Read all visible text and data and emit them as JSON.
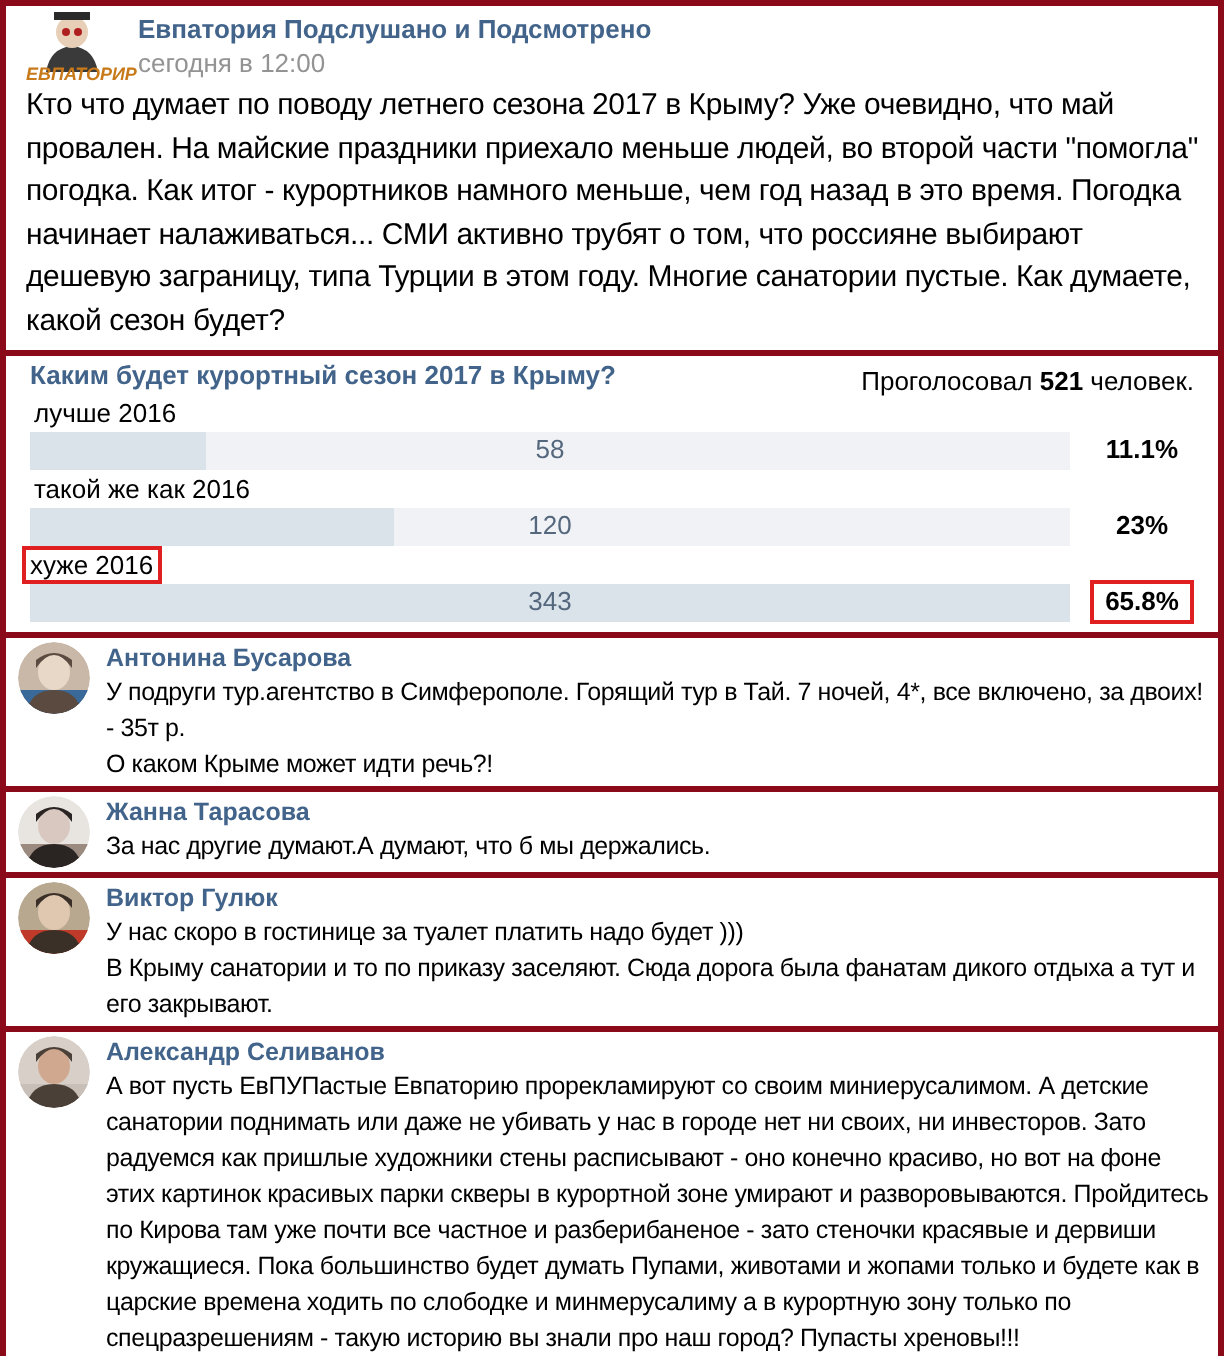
{
  "post": {
    "logo_text": "ЕВПАТОРИР",
    "author": "Евпатория Подслушано и Подсмотрено",
    "time": "сегодня в 12:00",
    "text": "Кто что думает по поводу летнего сезона 2017 в Крыму? Уже очевидно, что май провален. На майские праздники приехало меньше людей, во второй части \"помогла\" погодка. Как итог - курортников намного меньше, чем год назад в это время. Погодка начинает налаживаться... СМИ активно трубят о том, что россияне выбирают дешевую заграницу, типа Турции в этом году. Многие санатории пустые. Как думаете, какой сезон будет?"
  },
  "poll": {
    "title": "Каким будет курортный сезон 2017 в Крыму?",
    "voters": "Проголосовал **521** человек.",
    "options": [
      {
        "label": "лучше 2016",
        "count": "58",
        "percent": "11.1%",
        "level": 0.17,
        "highlighted": false
      },
      {
        "label": "такой же как 2016",
        "count": "120",
        "percent": "23%",
        "level": 0.35,
        "highlighted": false
      },
      {
        "label": "хуже 2016",
        "count": "343",
        "percent": "65.8%",
        "level": 1,
        "highlighted": true
      }
    ]
  },
  "comments": [
    {
      "author": "Антонина Бусарова",
      "paragraphs": [
        "У подруги тур.агентство в Симферополе. Горящий тур в Тай. 7 ночей, 4*, все включено, за двоих! - 35т р.",
        "О каком Крыме может идти речь?!"
      ]
    },
    {
      "author": "Жанна Тарасова",
      "paragraphs": [
        "За нас другие думают.А думают, что б мы держались."
      ]
    },
    {
      "author": "Виктор Гулюк",
      "paragraphs": [
        "У нас скоро в гостинице за туалет платить надо будет )))",
        "В Крыму санатории и то по приказу заселяют. Сюда дорога была фанатам дикого отдыха а тут и его закрывают."
      ]
    },
    {
      "author": "Александр Селиванов",
      "paragraphs": [
        "А вот пусть ЕвПУПастые Евпаторию прорекламируют со своим миниерусалимом. А детские санатории поднимать или даже не убивать у нас в городе нет ни своих, ни инвесторов. Зато радуемся как пришлые художники стены расписывают - оно конечно красиво, но вот на фоне этих картинок красивых парки скверы в курортной зоне умирают и разворовываются. Пройдитесь по Кирова там уже почти все частное и разберибаненое - зато стеночки красявые и дервиши кружащиеся. Пока большинство будет думать Пупами, животами и жопами только и будете как в царские времена ходить по слободке и минмерусалиму а в курортную зону только по спецразрешениям - такую историю вы знали про наш город? Пупасты хреновы!!!"
      ]
    }
  ]
}
